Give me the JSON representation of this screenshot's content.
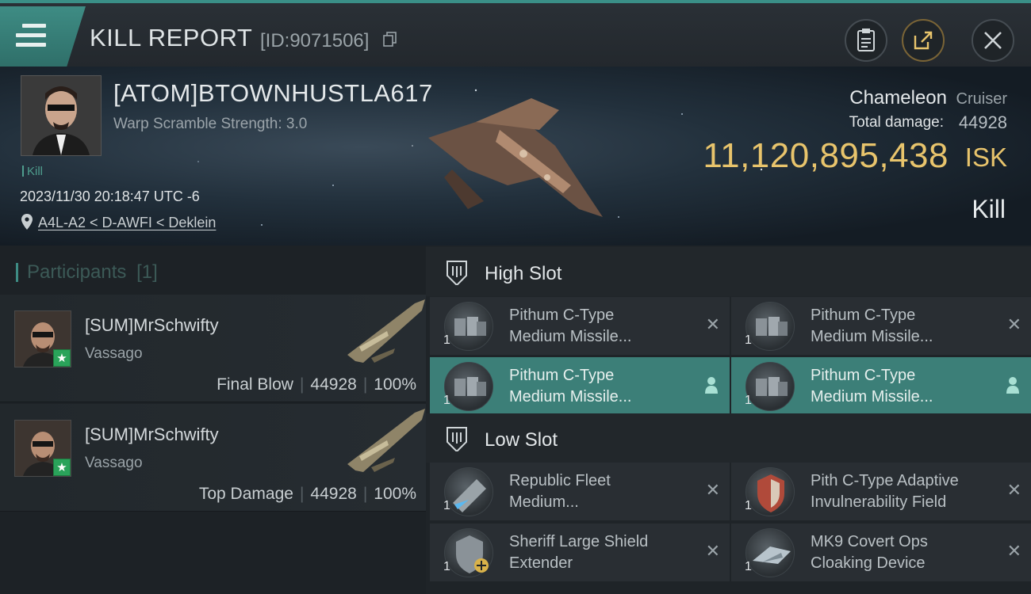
{
  "header": {
    "title": "KILL REPORT",
    "report_id": "[ID:9071506]",
    "icons": {
      "menu": "menu-icon",
      "copy": "copy-icon",
      "clipboard": "clipboard-icon",
      "export": "export-icon",
      "close": "close-icon"
    }
  },
  "victim": {
    "name": "[ATOM]BTOWNHUSTLA617",
    "warp_scramble": "Warp Scramble Strength: 3.0",
    "kill_tag": "Kill",
    "timestamp": "2023/11/30 20:18:47 UTC -6",
    "location": "A4L-A2 < D-AWFI < Deklein",
    "ship_name": "Chameleon",
    "ship_class": "Cruiser",
    "total_damage_label": "Total damage:",
    "total_damage_value": "44928",
    "isk_value": "11,120,895,438",
    "isk_unit": "ISK",
    "result": "Kill"
  },
  "participants": {
    "heading": "Participants",
    "count": "[1]",
    "items": [
      {
        "name": "[SUM]MrSchwifty",
        "ship": "Vassago",
        "role": "Final Blow",
        "damage": "44928",
        "percent": "100%"
      },
      {
        "name": "[SUM]MrSchwifty",
        "ship": "Vassago",
        "role": "Top Damage",
        "damage": "44928",
        "percent": "100%"
      }
    ]
  },
  "high_slot": {
    "title": "High Slot",
    "modules": [
      {
        "line1": "Pithum C-Type",
        "line2": "Medium Missile...",
        "qty": "1",
        "state": "destroyed"
      },
      {
        "line1": "Pithum C-Type",
        "line2": "Medium Missile...",
        "qty": "1",
        "state": "destroyed"
      },
      {
        "line1": "Pithum C-Type",
        "line2": "Medium Missile...",
        "qty": "1",
        "state": "dropped"
      },
      {
        "line1": "Pithum C-Type",
        "line2": "Medium Missile...",
        "qty": "1",
        "state": "dropped"
      }
    ]
  },
  "low_slot": {
    "title": "Low Slot",
    "modules": [
      {
        "line1": "Republic Fleet",
        "line2": "Medium...",
        "qty": "1",
        "state": "destroyed"
      },
      {
        "line1": "Pith C-Type Adaptive",
        "line2": "Invulnerability Field",
        "qty": "1",
        "state": "destroyed"
      },
      {
        "line1": "Sheriff Large Shield",
        "line2": "Extender",
        "qty": "1",
        "state": "destroyed"
      },
      {
        "line1": "MK9 Covert Ops",
        "line2": "Cloaking Device",
        "qty": "1",
        "state": "destroyed"
      }
    ]
  },
  "colors": {
    "accent": "#3e8c84",
    "isk": "#e8c46c",
    "highlight_row": "#3c7f78",
    "star_badge": "#2aa35a"
  }
}
